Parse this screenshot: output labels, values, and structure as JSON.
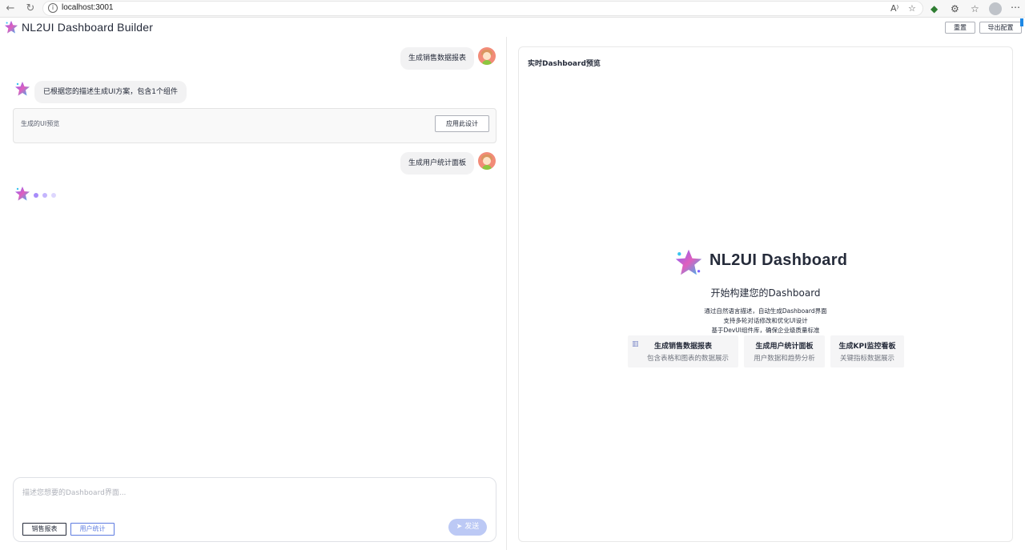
{
  "browser": {
    "url": "localhost:3001",
    "icons": [
      "back-icon",
      "reload-icon",
      "info-icon",
      "read-aloud-icon",
      "favorite-star-icon",
      "extension-icon",
      "puzzle-icon",
      "favorites-icon",
      "profile-icon",
      "more-icon"
    ]
  },
  "app": {
    "title": "NL2UI Dashboard Builder",
    "reset_label": "重置",
    "export_label": "导出配置"
  },
  "chat": {
    "messages": [
      {
        "role": "user",
        "text": "生成销售数据报表"
      },
      {
        "role": "bot",
        "text": "已根据您的描述生成UI方案，包含1个组件"
      },
      {
        "role": "user",
        "text": "生成用户统计面板"
      }
    ],
    "preview_card": {
      "label": "生成的UI预览",
      "apply_label": "应用此设计"
    },
    "input": {
      "placeholder": "描述您想要的Dashboard界面...",
      "chips": [
        "销售报表",
        "用户统计"
      ],
      "send_label": "发送"
    },
    "colors": {
      "dot1": "#a78bfa",
      "dot2": "#c4b5fd",
      "dot3": "#ddd6fe"
    }
  },
  "preview": {
    "title": "实时Dashboard预览",
    "hero_title": "NL2UI Dashboard",
    "hero_sub": "开始构建您的Dashboard",
    "hero_lines": [
      "通过自然语言描述，自动生成Dashboard界面",
      "支持多轮对话修改和优化UI设计",
      "基于DevUI组件库，确保企业级质量标准"
    ],
    "quick_cards": [
      {
        "title": "生成销售数据报表",
        "desc": "包含表格和图表的数据展示",
        "icon": "bar-chart-icon"
      },
      {
        "title": "生成用户统计面板",
        "desc": "用户数据和趋势分析"
      },
      {
        "title": "生成KPI监控看板",
        "desc": "关键指标数据展示"
      }
    ]
  }
}
